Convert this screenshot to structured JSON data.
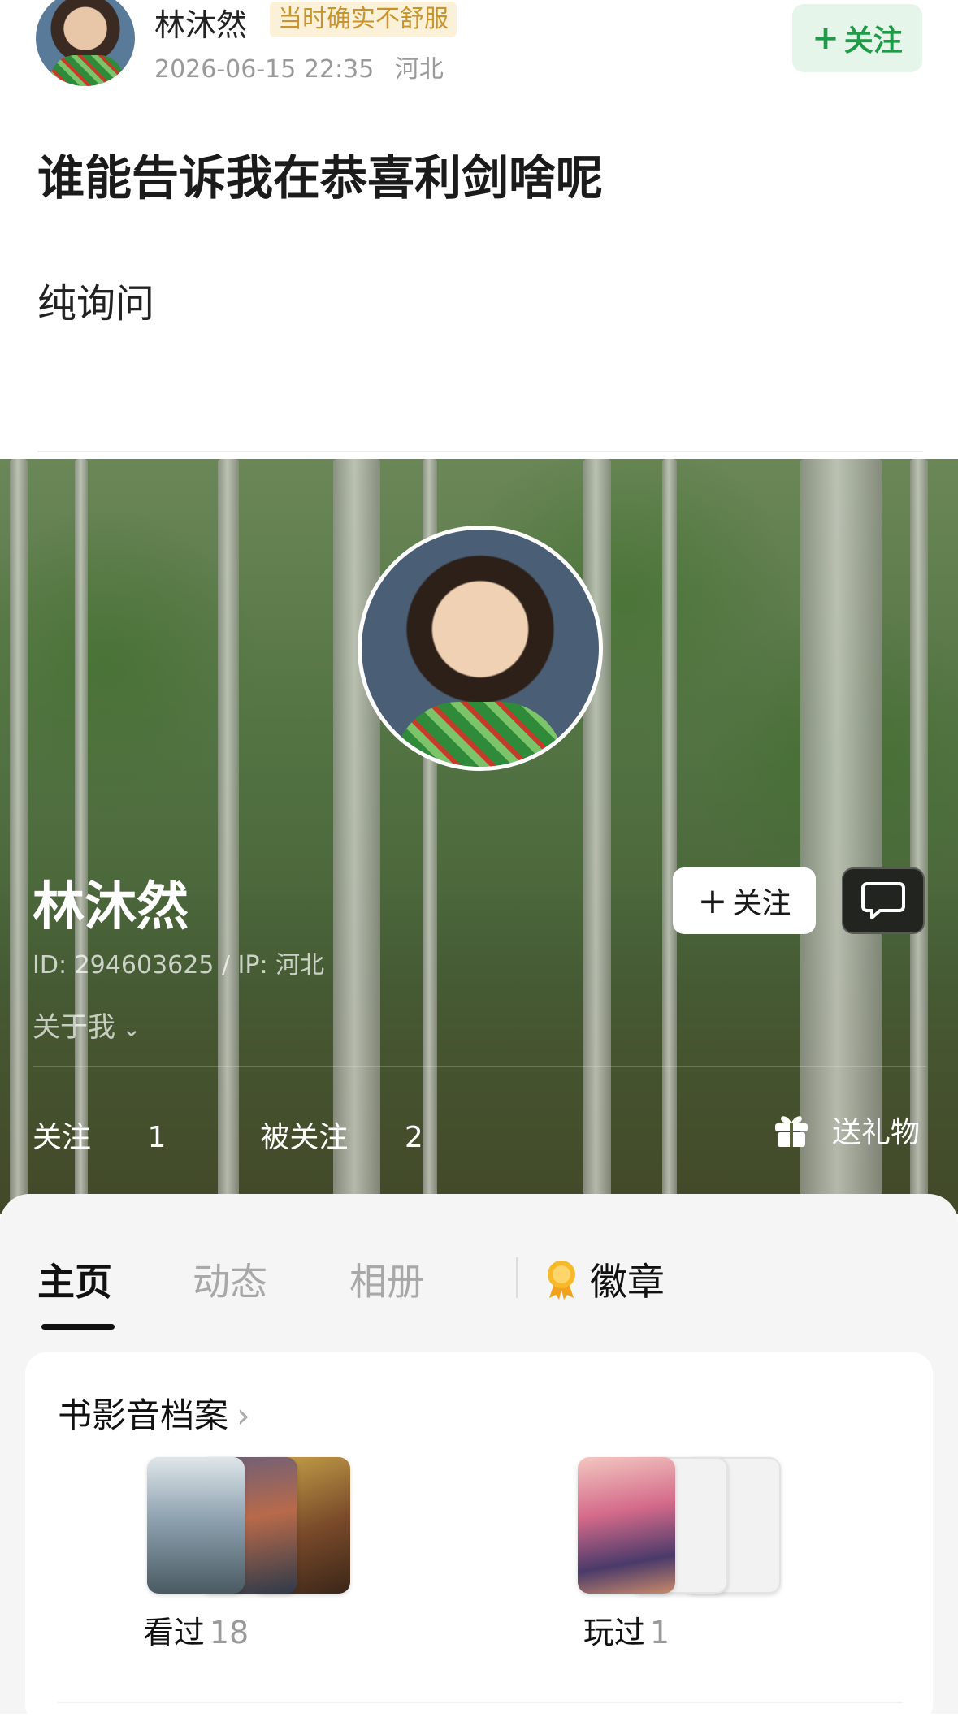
{
  "post": {
    "username": "林沐然",
    "user_tag": "当时确实不舒服",
    "date": "2026-06-15 22:35",
    "location": "河北",
    "follow_label": "关注",
    "title": "谁能告诉我在恭喜利剑啥呢",
    "body": "纯询问",
    "colors": {
      "follow_bg": "#e6f5ea",
      "follow_text": "#1f9b48",
      "tag_text": "#c9932e"
    }
  },
  "profile": {
    "name": "林沐然",
    "id_line": "ID: 294603625 / IP: 河北",
    "about_label": "关于我",
    "follow_label": "关注",
    "message_icon": "chat-bubble-icon",
    "following_label": "关注",
    "following_count": "1",
    "followers_label": "被关注",
    "followers_count": "2",
    "gift_label": "送礼物",
    "gift_icon": "gift-icon"
  },
  "tabs": [
    {
      "label": "主页",
      "active": true
    },
    {
      "label": "动态",
      "active": false
    },
    {
      "label": "相册",
      "active": false
    },
    {
      "label": "徽章",
      "active": false,
      "icon": "medal-icon"
    }
  ],
  "archive": {
    "title": "书影音档案",
    "watched_label": "看过",
    "watched_count": "18",
    "played_label": "玩过",
    "played_count": "1"
  }
}
